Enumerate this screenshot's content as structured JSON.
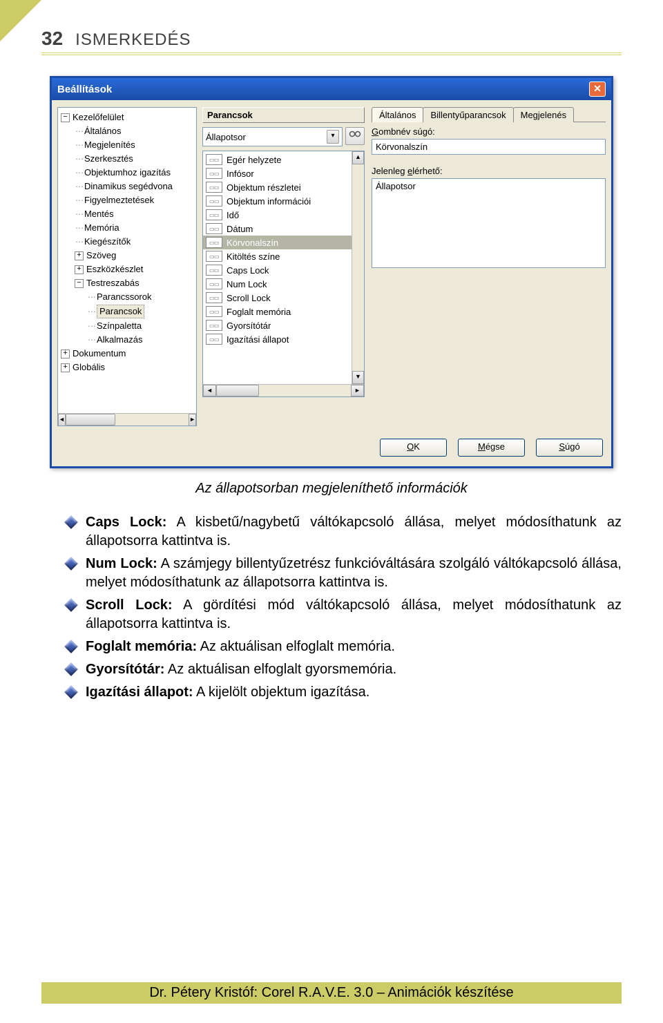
{
  "header": {
    "page_number": "32",
    "section": "ISMERKEDÉS"
  },
  "dialog": {
    "title": "Beállítások",
    "tree": {
      "root1": "Kezelőfelület",
      "items": [
        "Általános",
        "Megjelenítés",
        "Szerkesztés",
        "Objektumhoz igazítás",
        "Dinamikus segédvona",
        "Figyelmeztetések",
        "Mentés",
        "Memória",
        "Kiegészítők"
      ],
      "szoveg": "Szöveg",
      "eszkoz": "Eszközkészlet",
      "testre": "Testreszabás",
      "testre_items": [
        "Parancssorok",
        "Parancsok",
        "Színpaletta",
        "Alkalmazás"
      ],
      "dokumentum": "Dokumentum",
      "globalis": "Globális"
    },
    "middle": {
      "header": "Parancsok",
      "combo_value": "Állapotsor",
      "list": [
        "Egér helyzete",
        "Infósor",
        "Objektum részletei",
        "Objektum információi",
        "Idő",
        "Dátum",
        "Körvonalszín",
        "Kitöltés színe",
        "Caps Lock",
        "Num Lock",
        "Scroll Lock",
        "Foglalt memória",
        "Gyorsítótár",
        "Igazítási állapot"
      ],
      "selected_index": 6
    },
    "right": {
      "tabs": [
        "Általános",
        "Billentyűparancsok",
        "Megjelenés"
      ],
      "active_tab": 0,
      "label1_pre": "G",
      "label1_rest": "ombnév súgó:",
      "field1_value": "Körvonalszín",
      "label2": "Jelenleg ",
      "label2_u": "e",
      "label2_rest": "lérhető:",
      "field2_value": "Állapotsor"
    },
    "buttons": {
      "ok_u": "O",
      "ok_rest": "K",
      "cancel_u": "M",
      "cancel_rest": "égse",
      "help_u": "S",
      "help_rest": "úgó"
    }
  },
  "caption": "Az állapotsorban megjeleníthető információk",
  "list_items": [
    {
      "bold": "Caps Lock:",
      "text": " A kisbetű/nagybetű váltókapcsoló állása, melyet módosíthatunk az állapotsorra kattintva is."
    },
    {
      "bold": "Num Lock:",
      "text": " A számjegy billentyűzetrész funkcióváltására szolgáló váltókapcsoló állása, melyet módosíthatunk az állapotsorra kattintva is."
    },
    {
      "bold": "Scroll Lock:",
      "text": " A gördítési mód váltókapcsoló állása, melyet módosíthatunk az állapotsorra kattintva is."
    },
    {
      "bold": "Foglalt memória:",
      "text": " Az aktuálisan elfoglalt memória."
    },
    {
      "bold": "Gyorsítótár:",
      "text": " Az aktuálisan elfoglalt gyorsmemória."
    },
    {
      "bold": "Igazítási állapot:",
      "text": " A kijelölt objektum igazítása."
    }
  ],
  "footer": "Dr. Pétery Kristóf: Corel R.A.V.E. 3.0 – Animációk készítése"
}
